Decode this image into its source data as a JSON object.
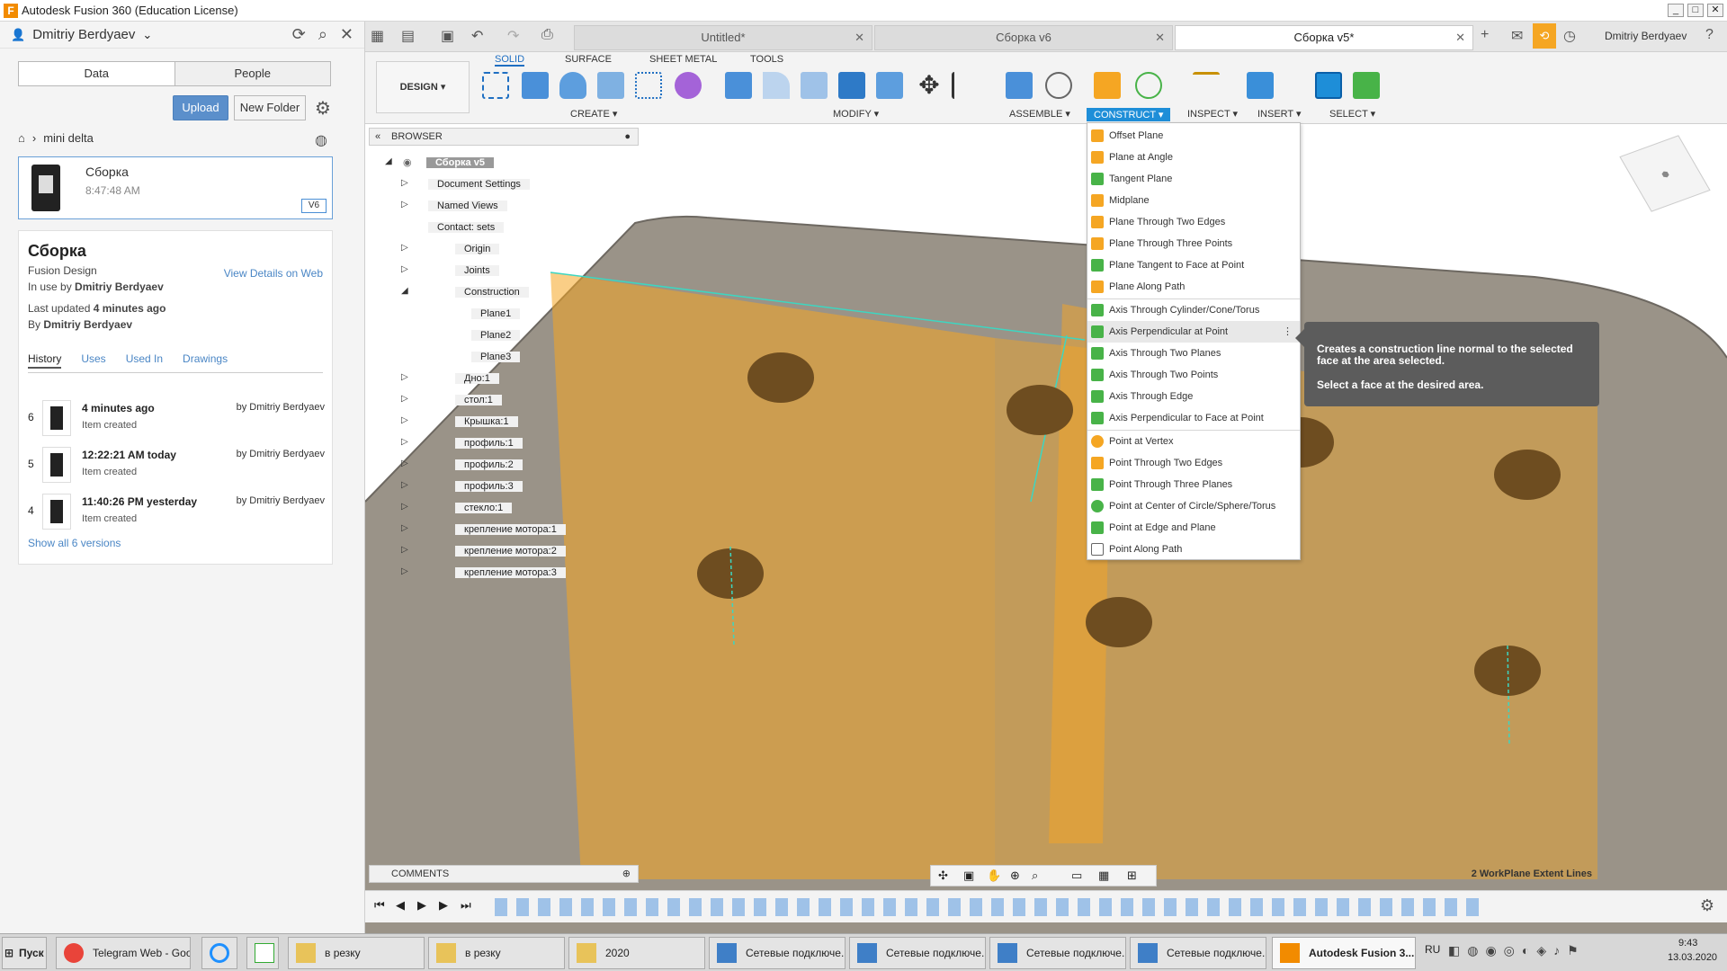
{
  "window": {
    "title": "Autodesk Fusion 360 (Education License)"
  },
  "data_panel": {
    "user_name": "Dmitriy Berdyaev",
    "segments": [
      "Data",
      "People"
    ],
    "upload_label": "Upload",
    "new_folder_label": "New Folder",
    "breadcrumb": "mini delta",
    "file": {
      "name": "Сборка",
      "time": "8:47:48 AM",
      "version": "V6"
    },
    "details": {
      "title": "Сборка",
      "type": "Fusion Design",
      "in_use_prefix": "In use by",
      "in_use_by": "Dmitriy Berdyaev",
      "view_details": "View Details on Web",
      "last_updated_prefix": "Last updated",
      "last_updated": "4 minutes ago",
      "by_prefix": "By",
      "by": "Dmitriy Berdyaev",
      "tabs": [
        "History",
        "Uses",
        "Used In",
        "Drawings"
      ],
      "history": [
        {
          "num": "6",
          "when": "4 minutes ago",
          "what": "Item created",
          "by": "by Dmitriy Berdyaev"
        },
        {
          "num": "5",
          "when": "12:22:21 AM today",
          "what": "Item created",
          "by": "by Dmitriy Berdyaev"
        },
        {
          "num": "4",
          "when": "11:40:26 PM yesterday",
          "what": "Item created",
          "by": "by Dmitriy Berdyaev"
        }
      ],
      "show_all": "Show all 6 versions"
    }
  },
  "doc_tabs": [
    "Untitled*",
    "Сборка v6",
    "Сборка v5*"
  ],
  "top_user": "Dmitriy Berdyaev",
  "toolbar": {
    "design_label": "DESIGN ▾",
    "workspace_tabs": [
      "SOLID",
      "SURFACE",
      "SHEET METAL",
      "TOOLS"
    ],
    "groups": [
      "CREATE ▾",
      "MODIFY ▾",
      "ASSEMBLE ▾",
      "CONSTRUCT ▾",
      "INSPECT ▾",
      "INSERT ▾",
      "SELECT ▾"
    ]
  },
  "browser": {
    "title": "BROWSER",
    "root": "Сборка v5",
    "items": [
      "Document Settings",
      "Named Views",
      "Contact: sets",
      "Origin",
      "Joints",
      "Construction",
      "Plane1",
      "Plane2",
      "Plane3",
      "Дно:1",
      "стол:1",
      "Крышка:1",
      "профиль:1",
      "профиль:2",
      "профиль:3",
      "стекло:1",
      "крепление мотора:1",
      "крепление мотора:2",
      "крепление мотора:3"
    ]
  },
  "construct_menu": {
    "items": [
      "Offset Plane",
      "Plane at Angle",
      "Tangent Plane",
      "Midplane",
      "Plane Through Two Edges",
      "Plane Through Three Points",
      "Plane Tangent to Face at Point",
      "Plane Along Path",
      "Axis Through Cylinder/Cone/Torus",
      "Axis Perpendicular at Point",
      "Axis Through Two Planes",
      "Axis Through Two Points",
      "Axis Through Edge",
      "Axis Perpendicular to Face at Point",
      "Point at Vertex",
      "Point Through Two Edges",
      "Point Through Three Planes",
      "Point at Center of Circle/Sphere/Torus",
      "Point at Edge and Plane",
      "Point Along Path"
    ],
    "hover_index": 9,
    "tooltip_line1": "Creates a construction line normal to the selected face at the area selected.",
    "tooltip_line2": "Select a face at the desired area."
  },
  "comments_label": "COMMENTS",
  "status_text": "2 WorkPlane Extent Lines",
  "taskbar": {
    "start": "Пуск",
    "items": [
      "Telegram Web - Goo...",
      "в резку",
      "в резку",
      "2020",
      "Сетевые подключе...",
      "Сетевые подключе...",
      "Сетевые подключе...",
      "Сетевые подключе...",
      "Autodesk Fusion 3..."
    ],
    "lang": "RU",
    "time": "9:43",
    "date": "13.03.2020"
  },
  "colors": {
    "accent": "#1e8ed8",
    "plane_orange": "#f5a623",
    "body_gray": "#9a9388"
  }
}
